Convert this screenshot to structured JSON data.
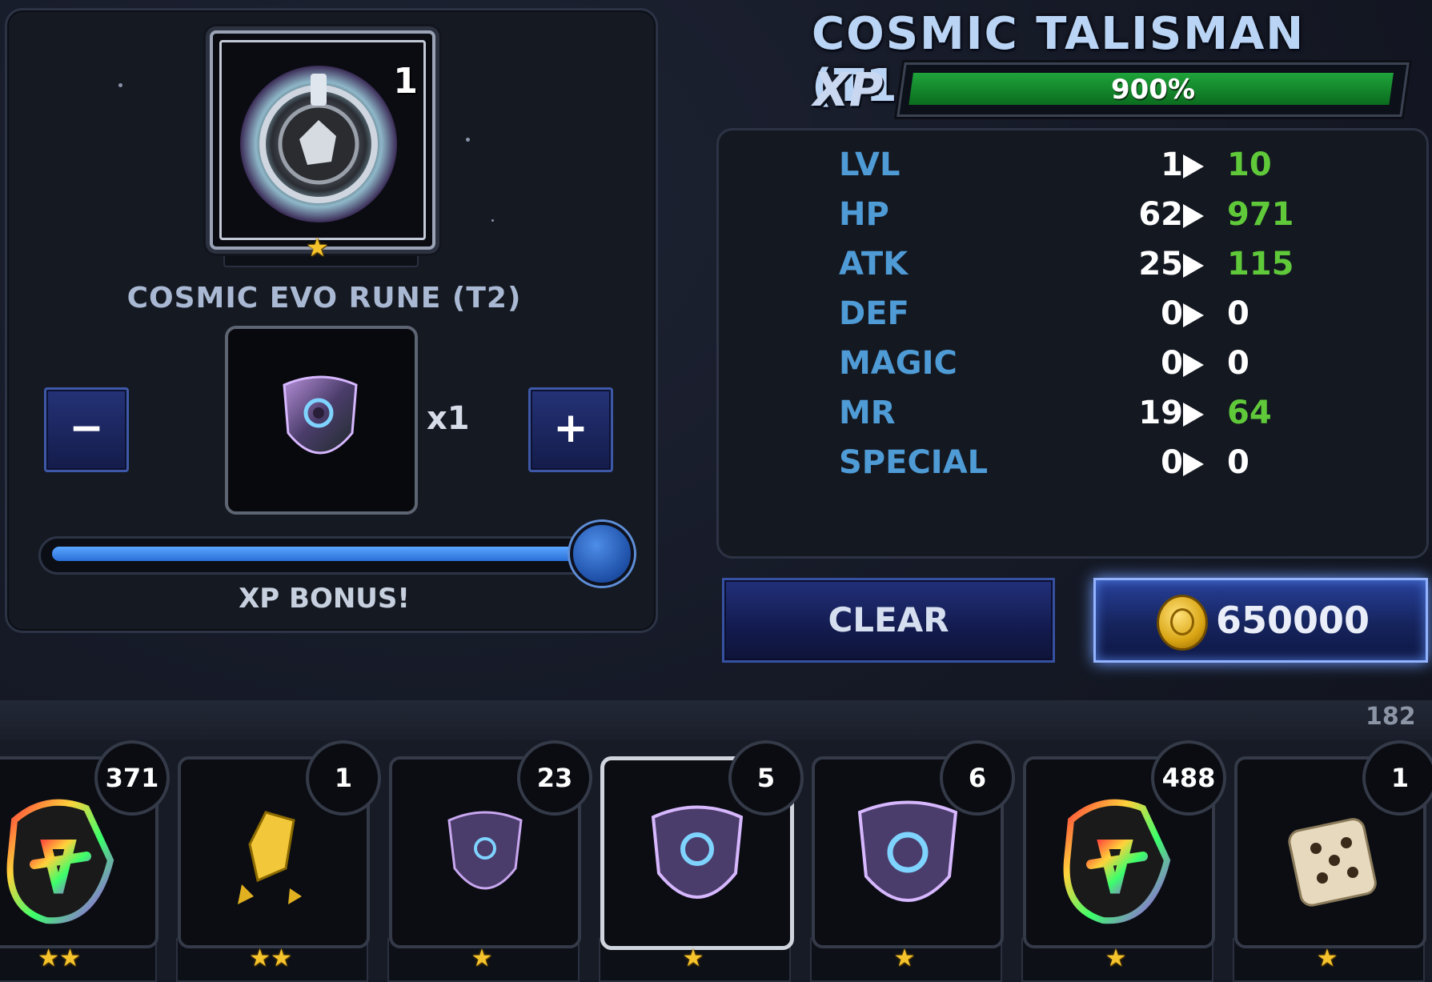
{
  "header": {
    "item_name": "COSMIC TALISMAN (T1)",
    "xp_label": "XP",
    "xp_percent": "900%",
    "xp_progress": 1.0
  },
  "talisman": {
    "icon": "cosmic-talisman-icon",
    "count": "1",
    "stars": "★"
  },
  "rune": {
    "title": "COSMIC EVO RUNE (T2)",
    "icon": "cosmic-evo-rune-icon",
    "quantity": "x1",
    "minus_label": "−",
    "plus_label": "+",
    "slider_value": 1.0,
    "bonus_text": "XP BONUS!"
  },
  "stats": [
    {
      "label": "LVL",
      "current": "1",
      "next": "10",
      "next_color": "#5fc93a"
    },
    {
      "label": "HP",
      "current": "62",
      "next": "971",
      "next_color": "#5fc93a"
    },
    {
      "label": "ATK",
      "current": "25",
      "next": "115",
      "next_color": "#5fc93a"
    },
    {
      "label": "DEF",
      "current": "0",
      "next": "0",
      "next_color": "#ffffff"
    },
    {
      "label": "MAGIC",
      "current": "0",
      "next": "0",
      "next_color": "#ffffff"
    },
    {
      "label": "MR",
      "current": "19",
      "next": "64",
      "next_color": "#5fc93a"
    },
    {
      "label": "SPECIAL",
      "current": "0",
      "next": "0",
      "next_color": "#ffffff"
    }
  ],
  "actions": {
    "clear_label": "CLEAR",
    "cost": "650000",
    "coin_icon": "gold-coin-icon"
  },
  "inventory": {
    "total_count": "182",
    "items": [
      {
        "icon": "rainbow-gem-icon",
        "count": "371",
        "stars": "★★",
        "selected": false
      },
      {
        "icon": "gold-shard-icon",
        "count": "1",
        "stars": "★★",
        "selected": false
      },
      {
        "icon": "cosmic-rune-small-icon",
        "count": "23",
        "stars": "★",
        "selected": false
      },
      {
        "icon": "cosmic-evo-rune-icon",
        "count": "5",
        "stars": "★",
        "selected": true
      },
      {
        "icon": "cosmic-rune-large-icon",
        "count": "6",
        "stars": "★",
        "selected": false
      },
      {
        "icon": "rainbow-gem-icon",
        "count": "488",
        "stars": "★",
        "selected": false
      },
      {
        "icon": "dice-icon",
        "count": "1",
        "stars": "★",
        "selected": false
      }
    ]
  },
  "colors": {
    "stat_label": "#4f9bd6",
    "xp_fill": "#1fa33a",
    "increase": "#5fc93a",
    "star": "#f5c32c"
  }
}
